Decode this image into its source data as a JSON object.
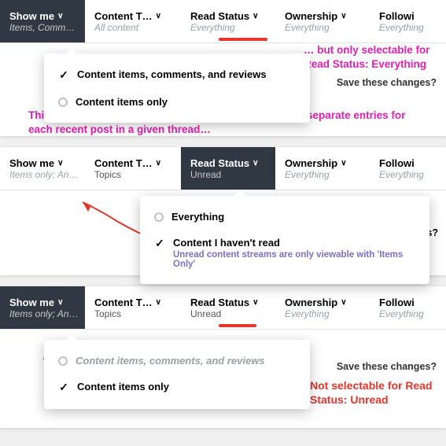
{
  "filters": {
    "show_me": "Show me",
    "content_type": "Content T…",
    "read_status": "Read Status",
    "ownership": "Ownership",
    "following": "Followi"
  },
  "values": {
    "items_comm": "Items, Comm…",
    "all_content": "All content",
    "everything": "Everything",
    "items_only_an": "Items only; An…",
    "topics": "Topics",
    "unread": "Unread"
  },
  "dropdown": {
    "items_full": "Content items, comments, and reviews",
    "items_only": "Content items only",
    "rs_everything": "Everything",
    "rs_havent_read": "Content I haven't read",
    "rs_note": "Unread content streams are only viewable with 'Items Only'"
  },
  "save_changes": "Save these changes?",
  "annotations": {
    "pink_right": "… but only selectable for Read Status: Everything",
    "pink_bottom": "This is the option you need to select if you want to see separate entries for each recent post in a given thread…",
    "red_bottom": "Not selectable for Read Status: Unread",
    "ges_label": "ges?"
  }
}
